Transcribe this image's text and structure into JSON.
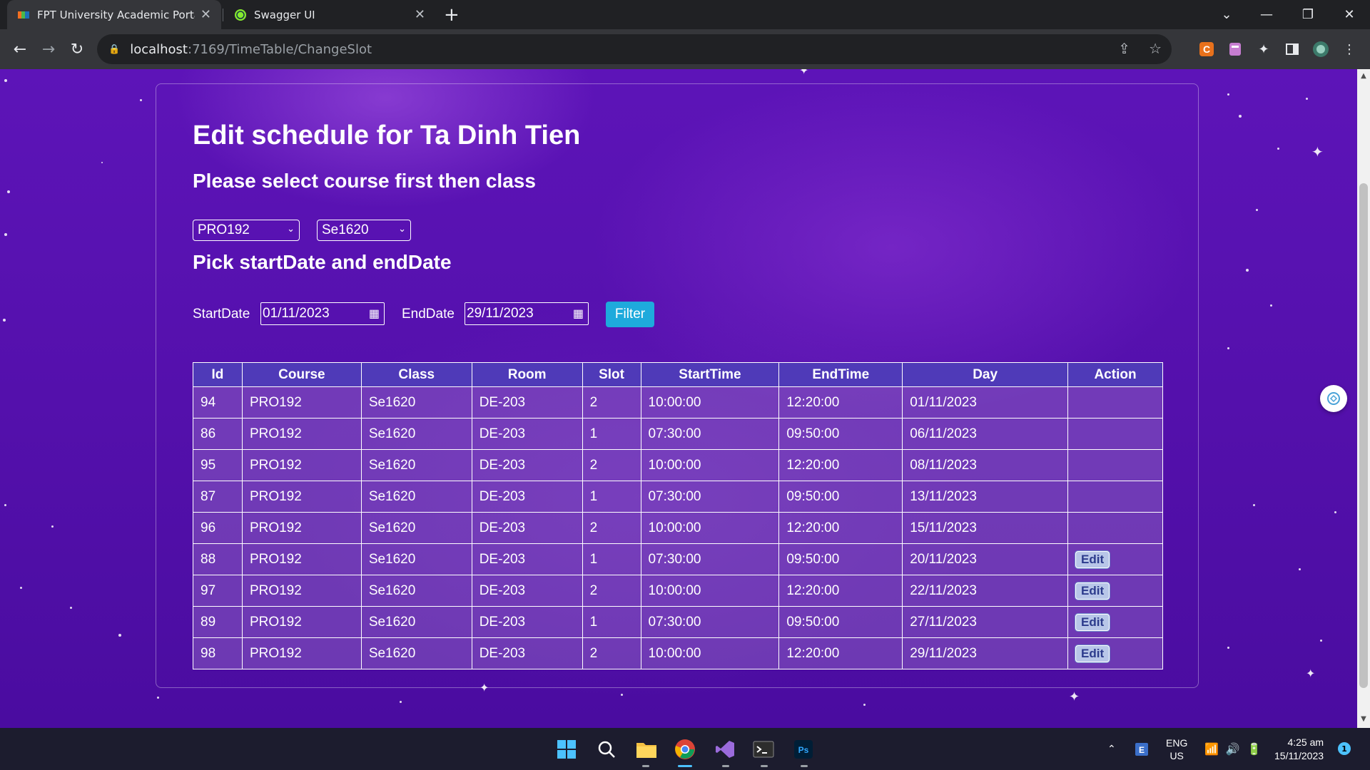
{
  "browser": {
    "tabs": [
      {
        "title": "FPT University Academic Portal -",
        "active": true
      },
      {
        "title": "Swagger UI",
        "active": false
      }
    ],
    "url_host": "localhost",
    "url_path": ":7169/TimeTable/ChangeSlot"
  },
  "page": {
    "title": "Edit schedule for Ta Dinh Tien",
    "course_section_heading": "Please select course first then class",
    "course_select": "PRO192",
    "class_select": "Se1620",
    "date_section_heading": "Pick startDate and endDate",
    "start_label": "StartDate",
    "start_value": "01/11/2023",
    "end_label": "EndDate",
    "end_value": "29/11/2023",
    "filter_label": "Filter"
  },
  "table": {
    "headers": [
      "Id",
      "Course",
      "Class",
      "Room",
      "Slot",
      "StartTime",
      "EndTime",
      "Day",
      "Action"
    ],
    "rows": [
      {
        "id": "94",
        "course": "PRO192",
        "class": "Se1620",
        "room": "DE-203",
        "slot": "2",
        "start": "10:00:00",
        "end": "12:20:00",
        "day": "01/11/2023",
        "action": ""
      },
      {
        "id": "86",
        "course": "PRO192",
        "class": "Se1620",
        "room": "DE-203",
        "slot": "1",
        "start": "07:30:00",
        "end": "09:50:00",
        "day": "06/11/2023",
        "action": ""
      },
      {
        "id": "95",
        "course": "PRO192",
        "class": "Se1620",
        "room": "DE-203",
        "slot": "2",
        "start": "10:00:00",
        "end": "12:20:00",
        "day": "08/11/2023",
        "action": ""
      },
      {
        "id": "87",
        "course": "PRO192",
        "class": "Se1620",
        "room": "DE-203",
        "slot": "1",
        "start": "07:30:00",
        "end": "09:50:00",
        "day": "13/11/2023",
        "action": ""
      },
      {
        "id": "96",
        "course": "PRO192",
        "class": "Se1620",
        "room": "DE-203",
        "slot": "2",
        "start": "10:00:00",
        "end": "12:20:00",
        "day": "15/11/2023",
        "action": ""
      },
      {
        "id": "88",
        "course": "PRO192",
        "class": "Se1620",
        "room": "DE-203",
        "slot": "1",
        "start": "07:30:00",
        "end": "09:50:00",
        "day": "20/11/2023",
        "action": "Edit"
      },
      {
        "id": "97",
        "course": "PRO192",
        "class": "Se1620",
        "room": "DE-203",
        "slot": "2",
        "start": "10:00:00",
        "end": "12:20:00",
        "day": "22/11/2023",
        "action": "Edit"
      },
      {
        "id": "89",
        "course": "PRO192",
        "class": "Se1620",
        "room": "DE-203",
        "slot": "1",
        "start": "07:30:00",
        "end": "09:50:00",
        "day": "27/11/2023",
        "action": "Edit"
      },
      {
        "id": "98",
        "course": "PRO192",
        "class": "Se1620",
        "room": "DE-203",
        "slot": "2",
        "start": "10:00:00",
        "end": "12:20:00",
        "day": "29/11/2023",
        "action": "Edit"
      }
    ]
  },
  "taskbar": {
    "lang_top": "ENG",
    "lang_bottom": "US",
    "time": "4:25 am",
    "date": "15/11/2023",
    "notification_count": "1"
  },
  "colors": {
    "page_bg": "#5410ac",
    "table_header": "#4f3ab8",
    "filter_button": "#1eaadc"
  }
}
